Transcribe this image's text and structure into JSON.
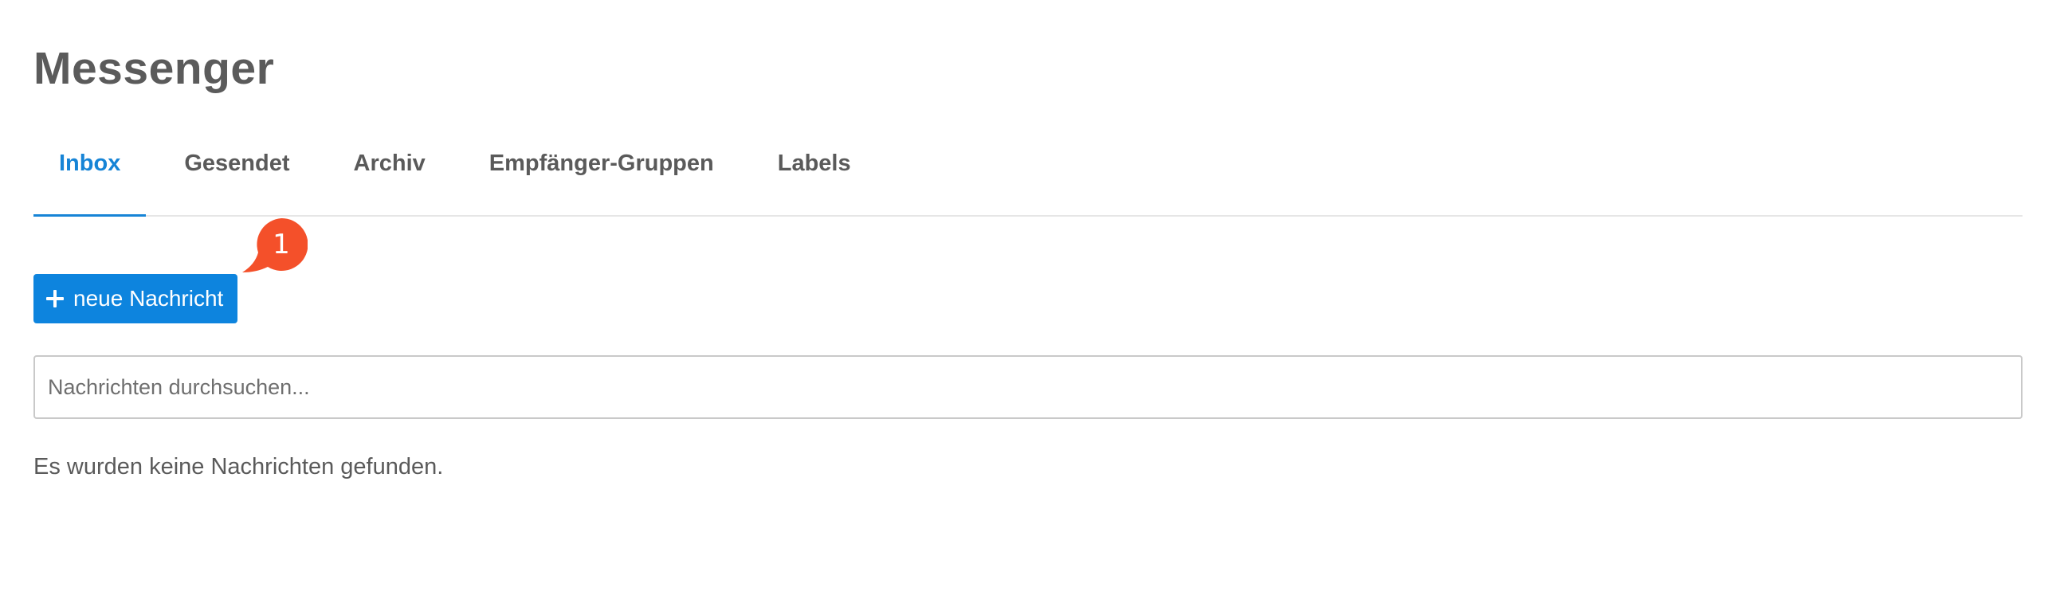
{
  "header": {
    "title": "Messenger"
  },
  "tabs": [
    {
      "label": "Inbox",
      "active": true
    },
    {
      "label": "Gesendet",
      "active": false
    },
    {
      "label": "Archiv",
      "active": false
    },
    {
      "label": "Empfänger-Gruppen",
      "active": false
    },
    {
      "label": "Labels",
      "active": false
    }
  ],
  "toolbar": {
    "new_message_label": "neue Nachricht",
    "new_message_icon": "plus-icon",
    "badge_count": "1"
  },
  "search": {
    "placeholder": "Nachrichten durchsuchen...",
    "value": ""
  },
  "messages": {
    "empty_text": "Es wurden keine Nachrichten gefunden."
  },
  "colors": {
    "accent": "#0d84de",
    "active_tab": "#1684d6",
    "badge": "#f4502a",
    "text": "#5a5a5a"
  }
}
